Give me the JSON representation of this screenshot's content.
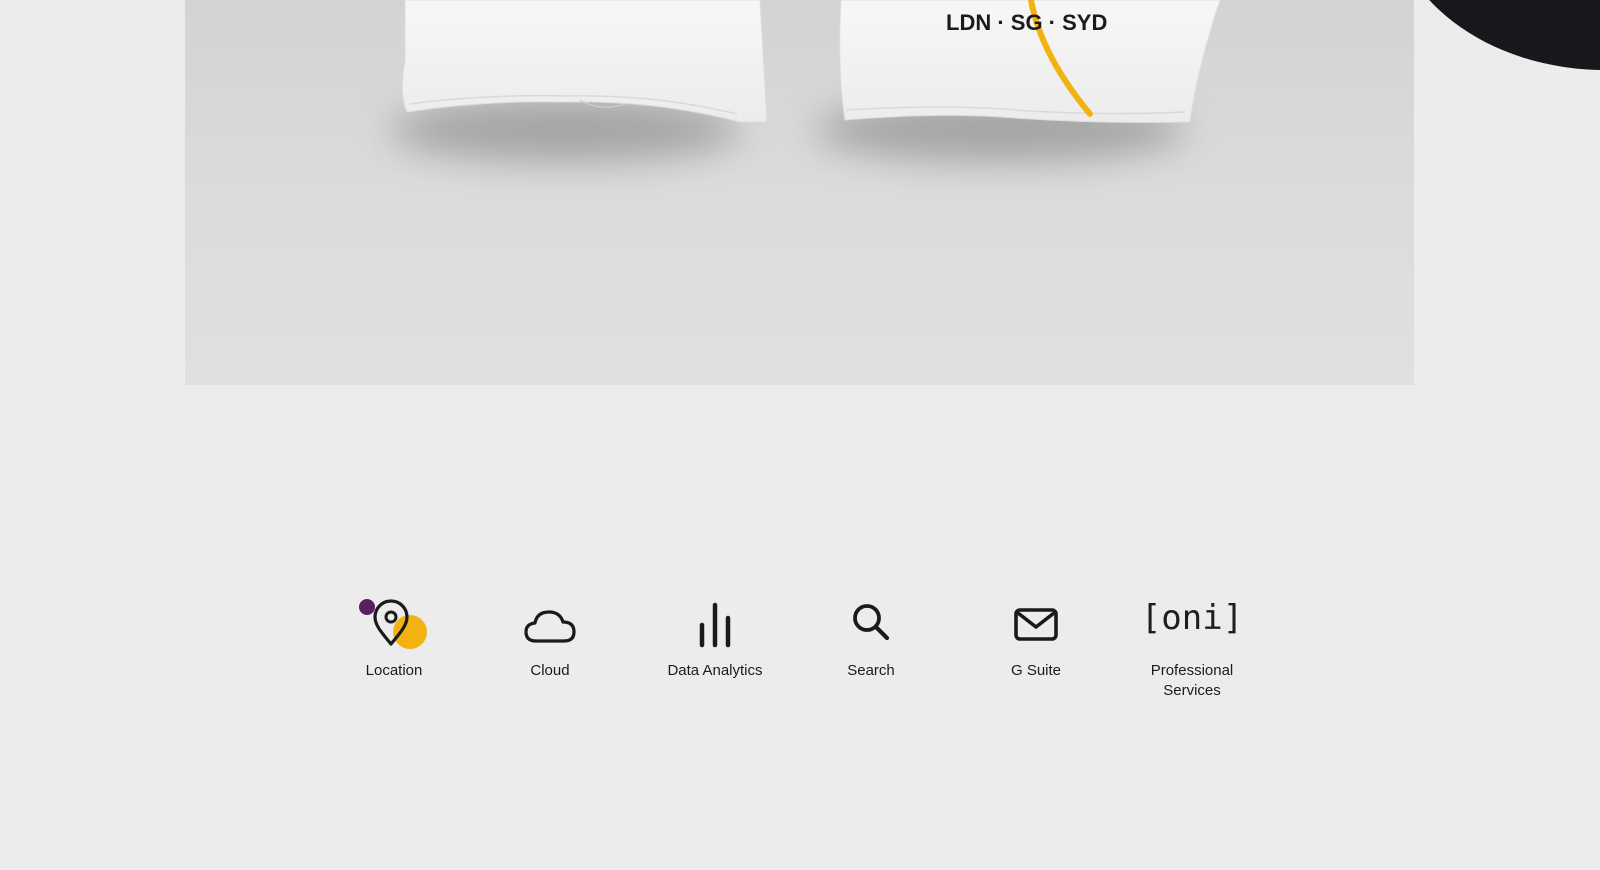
{
  "hero": {
    "shirt_print": "LDN · SG · SYD",
    "colors": {
      "accent_yellow": "#f2b312",
      "accent_purple": "#5a1f5f",
      "dark": "#16181b"
    }
  },
  "services": [
    {
      "label": "Location",
      "icon": "location-pin-icon"
    },
    {
      "label": "Cloud",
      "icon": "cloud-icon"
    },
    {
      "label": "Data Analytics",
      "icon": "bar-chart-icon"
    },
    {
      "label": "Search",
      "icon": "search-icon"
    },
    {
      "label": "G Suite",
      "icon": "mail-icon"
    },
    {
      "label": "Professional Services",
      "icon": "oni-bracket-icon",
      "glyph": "[oni]"
    }
  ]
}
